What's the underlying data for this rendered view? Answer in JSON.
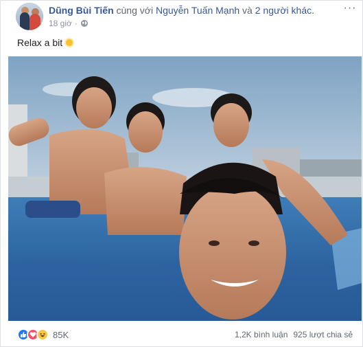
{
  "post": {
    "author": "Dũng Bùi Tiến",
    "with_text": " cùng với ",
    "tagged_person": "Nguyễn Tuấn Mạnh",
    "and_text": " và ",
    "others_link": "2 người khác.",
    "timestamp": "18 giờ",
    "dot": "·",
    "privacy_icon": "globe-icon",
    "caption": "Relax a bit",
    "caption_emoji": "sun-emoji",
    "more_label": "···"
  },
  "footer": {
    "reactions": [
      "like-reaction-icon",
      "love-reaction-icon",
      "haha-reaction-icon"
    ],
    "reaction_count": "85K",
    "comments": "1,2K bình luận",
    "shares": "925 lượt chia sẻ"
  },
  "colors": {
    "link": "#365899",
    "muted": "#90949c",
    "like": "#2078f4",
    "love": "#f25268",
    "haha": "#f7c843"
  }
}
